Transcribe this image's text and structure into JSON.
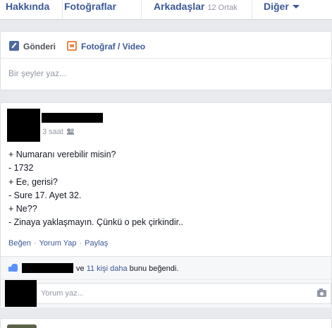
{
  "nav": {
    "tabs": [
      {
        "label": "Hakkında"
      },
      {
        "label": "Fotoğraflar"
      },
      {
        "label": "Arkadaşlar",
        "sub": "12 Ortak"
      },
      {
        "label": "Diğer"
      }
    ]
  },
  "composer": {
    "tab_post": "Gönderi",
    "tab_photo": "Fotoğraf / Video",
    "placeholder": "Bir şeyler yaz..."
  },
  "post": {
    "time": "3 saat",
    "privacy_icon": "friends-icon",
    "lines": [
      "+ Numaranı verebilir misin?",
      "- 1732",
      "+ Ee, gerisi?",
      "- Sure 17. Ayet 32.",
      "+ Ne??",
      "- Zinaya yaklaşmayın. Çünkü o pek çirkindir.."
    ],
    "actions": [
      "Beğen",
      "Yorum Yap",
      "Paylaş"
    ],
    "likes": {
      "connector": "ve",
      "others": "11 kişi daha",
      "suffix": "bunu beğendi."
    },
    "comment_placeholder": "Yorum yaz..."
  },
  "colors": {
    "link": "#3b5998",
    "background": "#e9eaed",
    "muted": "#9197a3"
  }
}
